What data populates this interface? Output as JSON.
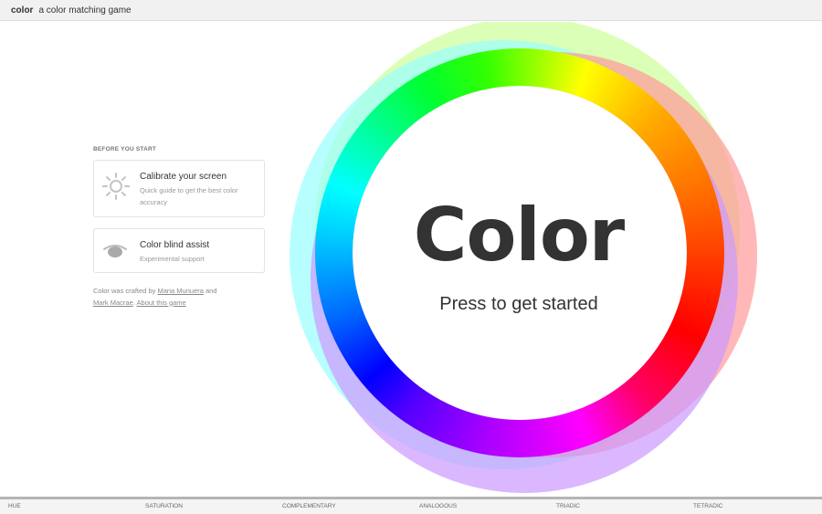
{
  "header": {
    "brand": "color",
    "tagline": "a color matching game"
  },
  "sidebar": {
    "heading": "BEFORE YOU START",
    "calibrate": {
      "title": "Calibrate your screen",
      "description": "Quick guide to get the best color accuracy",
      "icon": "sun-icon"
    },
    "color_blind": {
      "title": "Color blind assist",
      "description": "Experimental support",
      "icon": "eye-icon"
    },
    "credits": {
      "prefix": "Color was crafted by",
      "author1": "Maria Munuera",
      "and": "and",
      "author2": "Mark Macrae",
      "separator": ".",
      "about": "About this game"
    }
  },
  "main": {
    "title": "Color",
    "subtitle": "Press to get started"
  },
  "bottom_nav": {
    "tabs": [
      "HUE",
      "SATURATION",
      "COMPLEMENTARY",
      "ANALOGOUS",
      "TRIADIC",
      "TETRADIC"
    ]
  },
  "colors": {
    "ring_green": "#ccff99",
    "ring_cyan": "#99ffff",
    "ring_red": "#ff9999",
    "ring_violet": "#cc99ff",
    "text": "#333333"
  }
}
